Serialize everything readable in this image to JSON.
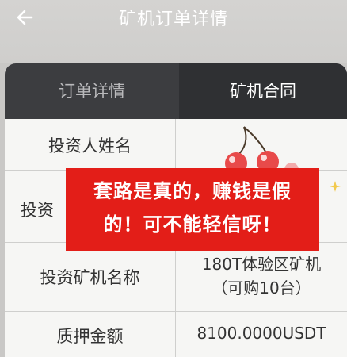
{
  "header": {
    "title": "矿机订单详情",
    "back_icon": "back-arrow-icon"
  },
  "tabs": [
    {
      "label": "订单详情"
    },
    {
      "label": "矿机合同"
    }
  ],
  "table": {
    "rows": [
      {
        "label": "投资人姓名",
        "value": ""
      },
      {
        "label": "投资",
        "value": ""
      },
      {
        "label": "投资矿机名称",
        "value_line1": "180T体验区矿机",
        "value_line2": "（可购10台）"
      },
      {
        "label": "质押金额",
        "value": "8100.0000USDT"
      }
    ]
  },
  "overlay": {
    "line1": "套路是真的，赚钱是假",
    "line2": "的！可不能轻信呀！",
    "color": "#e31e18"
  },
  "decoration": {
    "sticker_icon": "cherry-sticker-icon",
    "sparkle_icon": "sparkle-icon"
  }
}
